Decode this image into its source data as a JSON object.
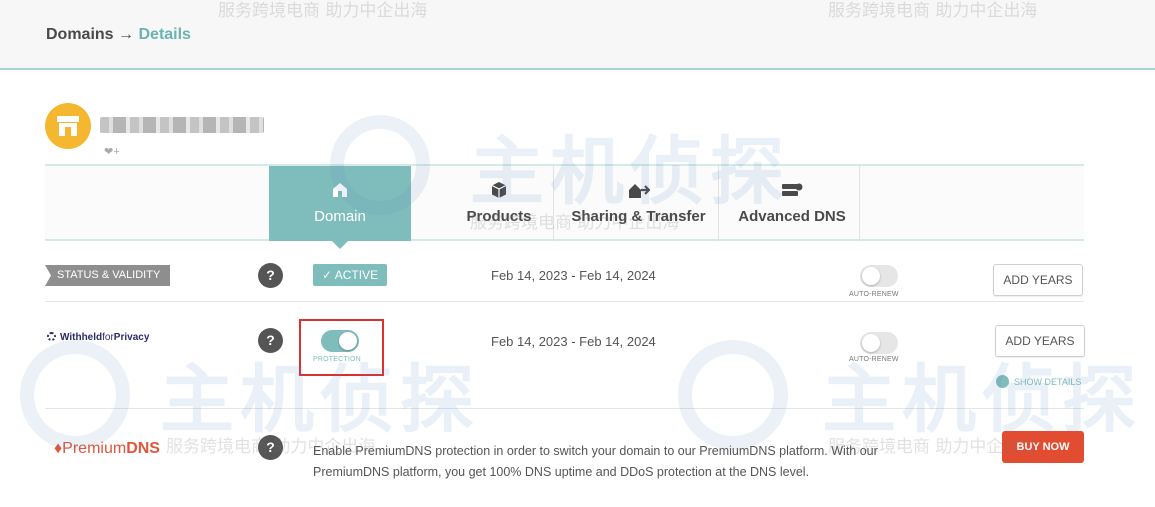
{
  "header": {
    "breadcrumb_root": "Domains",
    "breadcrumb_sep": "→",
    "breadcrumb_current": "Details"
  },
  "tabs": [
    {
      "label": "Domain",
      "icon": "house-icon",
      "active": true
    },
    {
      "label": "Products",
      "icon": "box-icon",
      "active": false
    },
    {
      "label": "Sharing & Transfer",
      "icon": "transfer-icon",
      "active": false
    },
    {
      "label": "Advanced DNS",
      "icon": "dns-server-icon",
      "active": false
    }
  ],
  "rows": {
    "status": {
      "label": "STATUS & VALIDITY",
      "help": "?",
      "badge": "✓ ACTIVE",
      "dates": "Feb 14, 2023 - Feb 14, 2024",
      "autorenew_label": "AUTO-RENEW",
      "autorenew_on": false,
      "action": "ADD YEARS"
    },
    "privacy": {
      "logo_bold": "Withheld",
      "logo_light": "for",
      "logo_end": "Privacy",
      "help": "?",
      "protection_label": "PROTECTION",
      "protection_on": true,
      "dates": "Feb 14, 2023 - Feb 14, 2024",
      "autorenew_label": "AUTO-RENEW",
      "autorenew_on": false,
      "action": "ADD YEARS",
      "show_details": "SHOW DETAILS"
    },
    "premium": {
      "logo_plain": "Premium",
      "logo_bold": "DNS",
      "help": "?",
      "description": "Enable PremiumDNS protection in order to switch your domain to our PremiumDNS platform. With our PremiumDNS platform, you get 100% DNS uptime and DDoS protection at the DNS level.",
      "action": "BUY NOW"
    }
  },
  "watermark": {
    "brand": "主机侦探",
    "slogan": "服务跨境电商 助力中企出海"
  },
  "colors": {
    "accent": "#7fbcbc",
    "logo_yellow": "#f5b730",
    "buy_red": "#e24c30",
    "highlight_red": "#d93030"
  }
}
